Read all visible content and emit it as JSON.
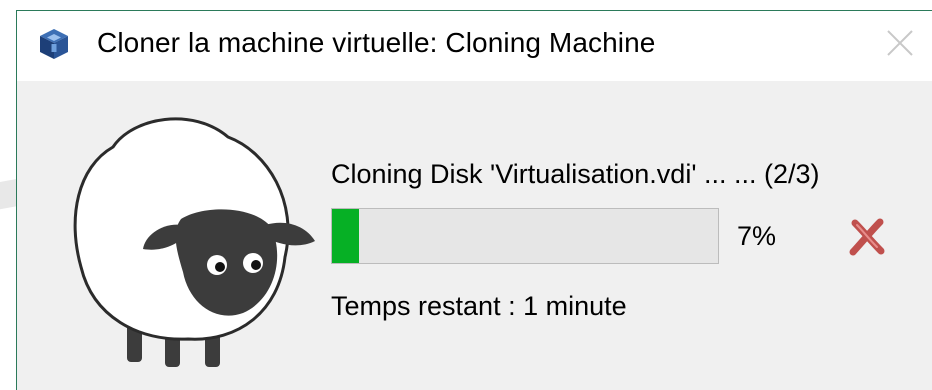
{
  "window": {
    "title": "Cloner la machine virtuelle: Cloning Machine",
    "app_icon": "virtualbox-icon",
    "close_icon": "close-icon"
  },
  "illustration": {
    "icon": "sheep-illustration"
  },
  "progress": {
    "status_text": "Cloning Disk 'Virtualisation.vdi' ... ... (2/3)",
    "percent": 7,
    "percent_label": "7%",
    "fill_color": "#06b025",
    "time_remaining": "Temps restant : 1 minute"
  },
  "cancel": {
    "icon": "cancel-x-icon",
    "color": "#c0504d"
  }
}
